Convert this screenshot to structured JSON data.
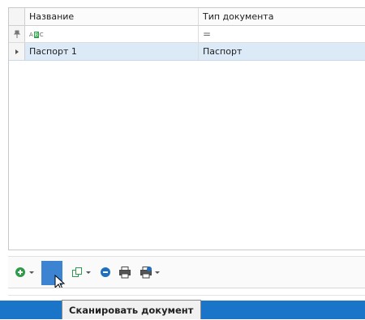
{
  "grid": {
    "columns": [
      "Название",
      "Тип документа"
    ],
    "filter_row": {
      "col1_icon": "abc-filter-icon",
      "col2_icon": "equals-filter-icon",
      "col2_symbol": "="
    },
    "rows": [
      {
        "name": "Паспорт 1",
        "doc_type": "Паспорт",
        "selected": true
      }
    ]
  },
  "toolbar": {
    "buttons": [
      {
        "icon": "add-circle-icon",
        "dropdown": true
      },
      {
        "icon": "scan-icon",
        "highlighted": true
      },
      {
        "icon": "copy-icon",
        "dropdown": true
      },
      {
        "icon": "remove-circle-icon"
      },
      {
        "icon": "print-icon"
      },
      {
        "icon": "print-settings-icon",
        "dropdown": true
      }
    ]
  },
  "tooltip": {
    "text": "Сканировать документ"
  },
  "colors": {
    "selection": "#dceaf7",
    "accent": "#1a74c7",
    "add": "#2e9b4a",
    "remove": "#1f6fc0"
  }
}
